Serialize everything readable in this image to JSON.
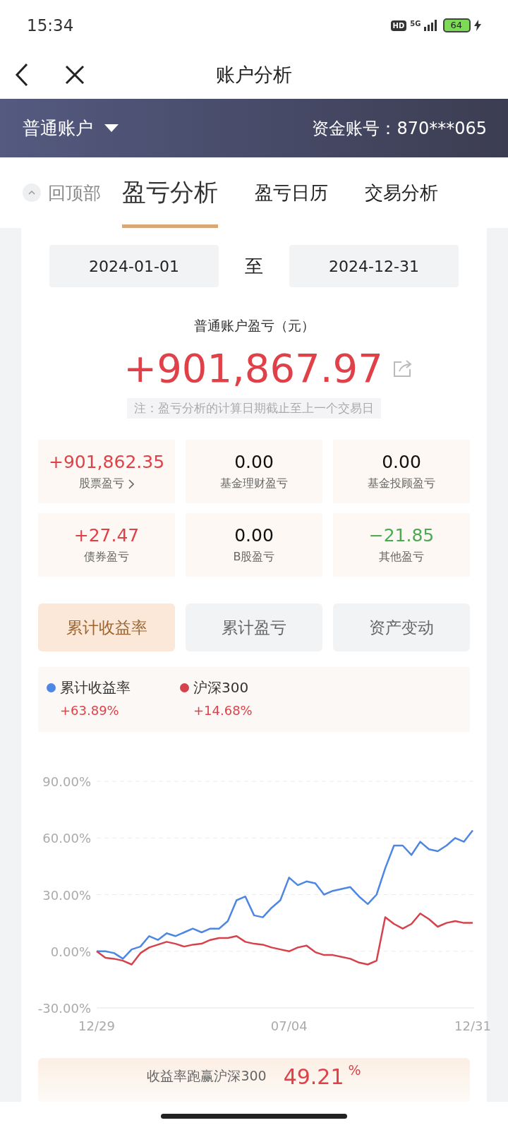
{
  "status_bar": {
    "time": "15:34",
    "hd": "HD",
    "network": "5G",
    "battery": "64"
  },
  "header": {
    "title": "账户分析"
  },
  "account": {
    "name": "普通账户",
    "number_label": "资金账号：870***065"
  },
  "back_to_top": "回顶部",
  "tabs": [
    {
      "label": "盈亏分析",
      "selected": true
    },
    {
      "label": "盈亏日历",
      "selected": false
    },
    {
      "label": "交易分析",
      "selected": false
    }
  ],
  "date_range": {
    "start": "2024-01-01",
    "separator": "至",
    "end": "2024-12-31"
  },
  "total": {
    "label": "普通账户盈亏（元）",
    "value": "+901,867.97",
    "note": "注：盈亏分析的计算日期截止至上一个交易日"
  },
  "breakdown": [
    {
      "value": "+901,862.35",
      "label": "股票盈亏",
      "kind": "gain",
      "link": true
    },
    {
      "value": "0.00",
      "label": "基金理财盈亏",
      "kind": "zero",
      "link": false
    },
    {
      "value": "0.00",
      "label": "基金投顾盈亏",
      "kind": "zero",
      "link": false
    },
    {
      "value": "+27.47",
      "label": "债券盈亏",
      "kind": "gain",
      "link": false
    },
    {
      "value": "0.00",
      "label": "B股盈亏",
      "kind": "zero",
      "link": false
    },
    {
      "value": "−21.85",
      "label": "其他盈亏",
      "kind": "loss",
      "link": false
    }
  ],
  "metric_tabs": [
    {
      "label": "累计收益率",
      "selected": true
    },
    {
      "label": "累计盈亏",
      "selected": false
    },
    {
      "label": "资产变动",
      "selected": false
    }
  ],
  "legend": [
    {
      "value": "+63.89%"
    },
    {
      "value": "+14.68%"
    }
  ],
  "chart_data": {
    "type": "line",
    "categories": [
      "12/29",
      null,
      null,
      null,
      null,
      null,
      null,
      null,
      null,
      null,
      null,
      null,
      null,
      null,
      null,
      null,
      null,
      null,
      null,
      null,
      null,
      null,
      "07/04",
      null,
      null,
      null,
      null,
      null,
      null,
      null,
      null,
      null,
      null,
      null,
      null,
      null,
      null,
      null,
      null,
      null,
      null,
      null,
      null,
      "12/31"
    ],
    "series": [
      {
        "name": "累计收益率",
        "color": "#4e86e4",
        "values": [
          0,
          0,
          -1,
          -4,
          1,
          2.5,
          8,
          6,
          9.5,
          8,
          10,
          12,
          10,
          12,
          12,
          16,
          27,
          29,
          19,
          18,
          23,
          27,
          39,
          35,
          37,
          36,
          30,
          32,
          33,
          34,
          29,
          25,
          30,
          44,
          56,
          56,
          51,
          58,
          54,
          53,
          56,
          60,
          58,
          64
        ]
      },
      {
        "name": "沪深300",
        "color": "#d5424b",
        "values": [
          0,
          -3.5,
          -4,
          -5,
          -7,
          -1,
          2,
          3.5,
          5,
          4,
          2.5,
          3.5,
          4,
          6,
          7,
          7,
          8,
          5,
          4,
          3.5,
          2,
          1,
          0,
          2,
          3,
          -0.5,
          -2,
          -2,
          -3,
          -4,
          -6,
          -7,
          -5,
          18,
          14.5,
          12,
          14.5,
          20,
          17,
          13,
          15,
          16,
          15,
          15
        ]
      }
    ],
    "grid": true,
    "ylim": [
      -30,
      90
    ],
    "yticks": [
      {
        "value": 90,
        "label": "90.00%"
      },
      {
        "value": 60,
        "label": "60.00%"
      },
      {
        "value": 30,
        "label": "30.00%"
      },
      {
        "value": 0,
        "label": "0.00%"
      },
      {
        "value": -30,
        "label": "-30.00%"
      }
    ]
  },
  "outperform": {
    "label": "收益率跑赢沪深300",
    "value": "49.21",
    "unit": "%"
  }
}
